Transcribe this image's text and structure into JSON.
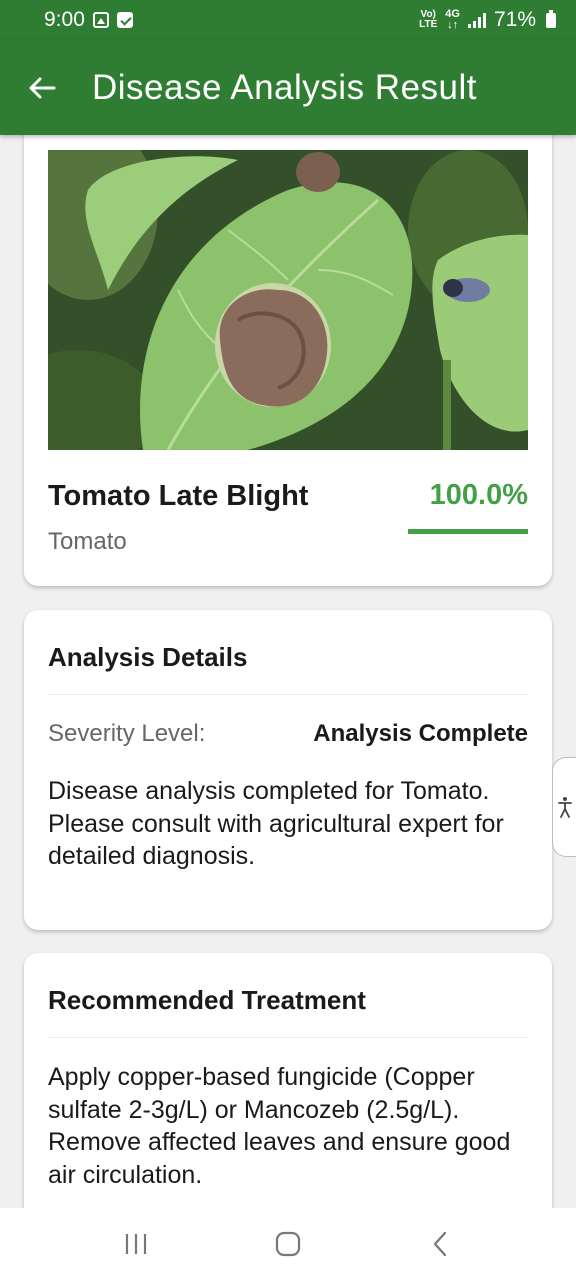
{
  "status_bar": {
    "time": "9:00",
    "lte_top": "Vo)",
    "lte_bottom": "LTE",
    "network": "4G",
    "battery": "71%"
  },
  "app_bar": {
    "title": "Disease Analysis Result",
    "back_icon": "arrow-left-icon"
  },
  "result": {
    "disease_name": "Tomato Late Blight",
    "crop": "Tomato",
    "confidence_text": "100.0%",
    "confidence_fraction": 1.0,
    "accent_color": "#43a047"
  },
  "analysis": {
    "title": "Analysis Details",
    "severity_label": "Severity Level:",
    "severity_value": "Analysis Complete",
    "description": "Disease analysis completed for Tomato. Please consult with agricultural expert for detailed diagnosis."
  },
  "treatment": {
    "title": "Recommended Treatment",
    "text": "Apply copper-based fungicide (Copper sulfate 2-3g/L) or Mancozeb (2.5g/L). Remove affected leaves and ensure good air circulation."
  },
  "nav": {
    "recents_icon": "recents-icon",
    "home_icon": "home-icon",
    "back_icon": "back-chevron-icon"
  },
  "colors": {
    "app_bar": "#2e7d32",
    "background": "#f0f0f0"
  }
}
